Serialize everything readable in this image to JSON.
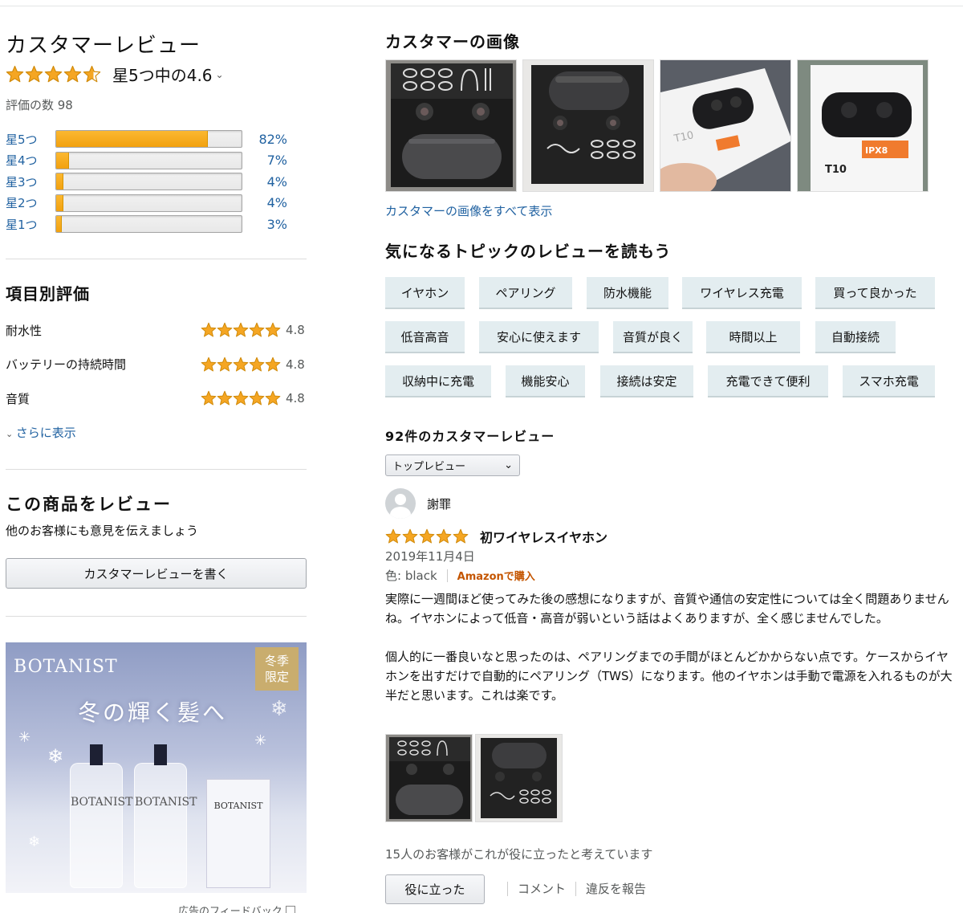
{
  "summary": {
    "heading": "カスタマーレビュー",
    "stars_value": 4.6,
    "rating_text": "星5つ中の4.6",
    "rating_count": "評価の数 98",
    "histogram": [
      {
        "label": "星5つ",
        "percent": 82,
        "percent_text": "82%"
      },
      {
        "label": "星4つ",
        "percent": 7,
        "percent_text": "7%"
      },
      {
        "label": "星3つ",
        "percent": 4,
        "percent_text": "4%"
      },
      {
        "label": "星2つ",
        "percent": 4,
        "percent_text": "4%"
      },
      {
        "label": "星1つ",
        "percent": 3,
        "percent_text": "3%"
      }
    ]
  },
  "attributes": {
    "heading": "項目別評価",
    "items": [
      {
        "name": "耐水性",
        "stars": 5,
        "value": "4.8"
      },
      {
        "name": "バッテリーの持続時間",
        "stars": 5,
        "value": "4.8"
      },
      {
        "name": "音質",
        "stars": 5,
        "value": "4.8"
      }
    ],
    "more_label": "さらに表示"
  },
  "write_review": {
    "heading": "この商品をレビュー",
    "subtext": "他のお客様にも意見を伝えましょう",
    "button_label": "カスタマーレビューを書く"
  },
  "ad": {
    "brand": "BOTANIST",
    "badge_line1": "冬季",
    "badge_line2": "限定",
    "tagline": "冬の輝く髪へ",
    "bottle_label": "BOTANIST",
    "feedback_label": "広告のフィードバック"
  },
  "customer_images": {
    "heading": "カスタマーの画像",
    "see_all_label": "カスタマーの画像をすべて表示",
    "product_text": "T10",
    "ipx_text": "IPX8"
  },
  "topics": {
    "heading": "気になるトピックのレビューを読もう",
    "chips": [
      "イヤホン",
      "ペアリング",
      "防水機能",
      "ワイヤレス充電",
      "買って良かった",
      "低音高音",
      "安心に使えます",
      "音質が良く",
      "時間以上",
      "自動接続",
      "収納中に充電",
      "機能安心",
      "接続は安定",
      "充電できて便利",
      "スマホ充電"
    ]
  },
  "reviews": {
    "count_heading": "92件のカスタマーレビュー",
    "sort_selected": "トップレビュー",
    "review": {
      "author": "謝罪",
      "stars": 5,
      "title": "初ワイヤレスイヤホン",
      "date": "2019年11月4日",
      "variant": "色: black",
      "verified": "Amazonで購入",
      "body_p1": "実際に一週間ほど使ってみた後の感想になりますが、音質や通信の安定性については全く問題ありませんね。イヤホンによって低音・高音が弱いという話はよくありますが、全く感じませんでした。",
      "body_p2": "個人的に一番良いなと思ったのは、ペアリングまでの手間がほとんどかからない点です。ケースからイヤホンを出すだけで自動的にペアリング（TWS）になります。他のイヤホンは手動で電源を入れるものが大半だと思います。これは楽です。",
      "helpful_text": "15人のお客様がこれが役に立ったと考えています",
      "helpful_button": "役に立った",
      "comment_label": "コメント",
      "report_label": "違反を報告"
    }
  },
  "colors": {
    "link": "#2162a1",
    "star": "#f5a623",
    "chip_bg": "#e3edf0",
    "verified": "#c45500"
  }
}
